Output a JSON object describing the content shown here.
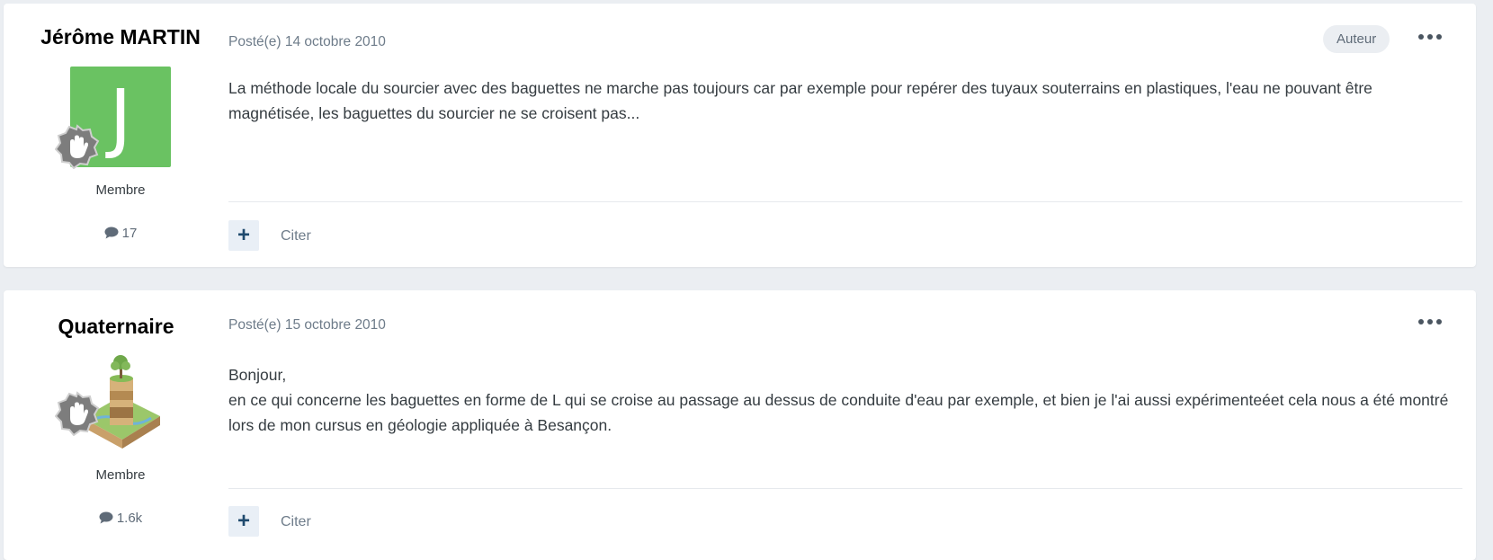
{
  "posts": [
    {
      "author": "Jérôme MARTIN",
      "avatar_letter": "J",
      "avatar_color": "#6ac262",
      "role": "Membre",
      "post_count": "17",
      "posted": "Posté(e) 14 octobre 2010",
      "badge": "Auteur",
      "body": [
        "La méthode locale du sourcier avec des baguettes ne marche pas toujours car par exemple pour repérer des tuyaux souterrains en plastiques, l'eau ne pouvant être magnétisée, les baguettes du sourcier ne se croisent pas..."
      ],
      "plus_label": "+",
      "quote_label": "Citer"
    },
    {
      "author": "Quaternaire",
      "role": "Membre",
      "post_count": "1.6k",
      "posted": "Posté(e) 15 octobre 2010",
      "body": [
        "Bonjour,",
        "en ce qui concerne les baguettes en forme de L qui se croise au passage au dessus de conduite d'eau par exemple, et bien je l'ai aussi expérimenteéet cela nous a été montré lors de mon cursus en géologie appliquée à Besançon."
      ],
      "plus_label": "+",
      "quote_label": "Citer"
    }
  ],
  "icons": {
    "more": "ellipsis-icon",
    "comment": "comment-icon",
    "rank": "rank-badge-icon"
  }
}
